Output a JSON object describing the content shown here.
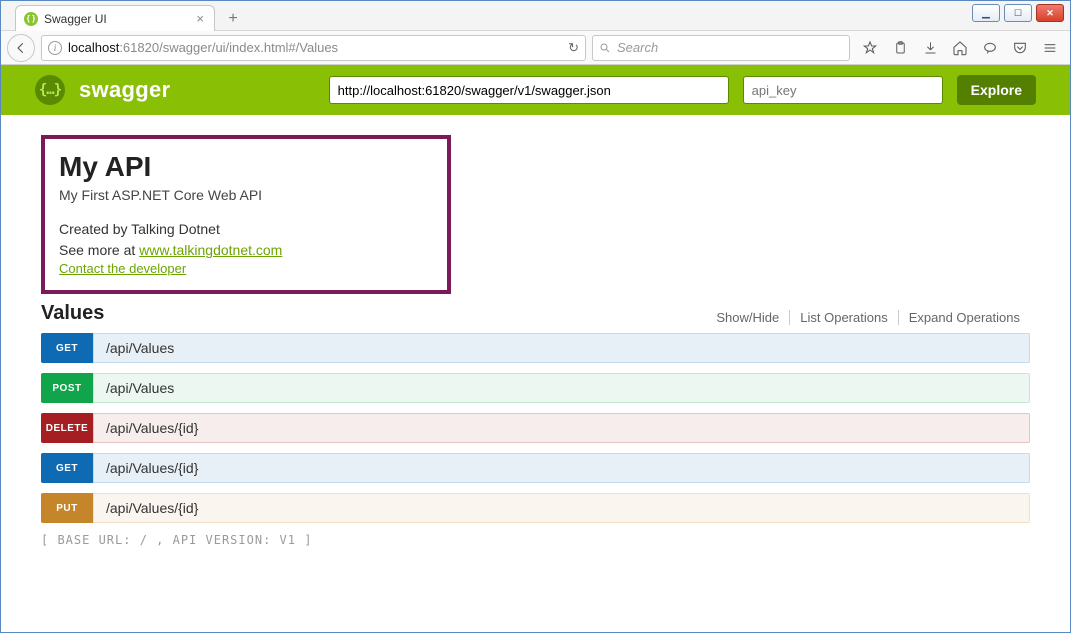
{
  "window": {
    "tab_title": "Swagger UI",
    "url_host": "localhost",
    "url_port": ":61820",
    "url_path": "/swagger/ui/index.html#/Values",
    "search_placeholder": "Search"
  },
  "header": {
    "brand": "swagger",
    "spec_url": "http://localhost:61820/swagger/v1/swagger.json",
    "api_key_placeholder": "api_key",
    "explore_label": "Explore"
  },
  "api": {
    "title": "My API",
    "subtitle": "My First ASP.NET Core Web API",
    "created_by": "Created by Talking Dotnet",
    "see_more_prefix": "See more at ",
    "see_more_link": "www.talkingdotnet.com",
    "contact": "Contact the developer"
  },
  "section": {
    "name": "Values",
    "links": {
      "showhide": "Show/Hide",
      "list": "List Operations",
      "expand": "Expand Operations"
    }
  },
  "operations": [
    {
      "method": "GET",
      "path": "/api/Values",
      "cls": "op-get"
    },
    {
      "method": "POST",
      "path": "/api/Values",
      "cls": "op-post"
    },
    {
      "method": "DELETE",
      "path": "/api/Values/{id}",
      "cls": "op-delete"
    },
    {
      "method": "GET",
      "path": "/api/Values/{id}",
      "cls": "op-get"
    },
    {
      "method": "PUT",
      "path": "/api/Values/{id}",
      "cls": "op-put"
    }
  ],
  "footer": "[ BASE URL: / , API VERSION: V1 ]"
}
